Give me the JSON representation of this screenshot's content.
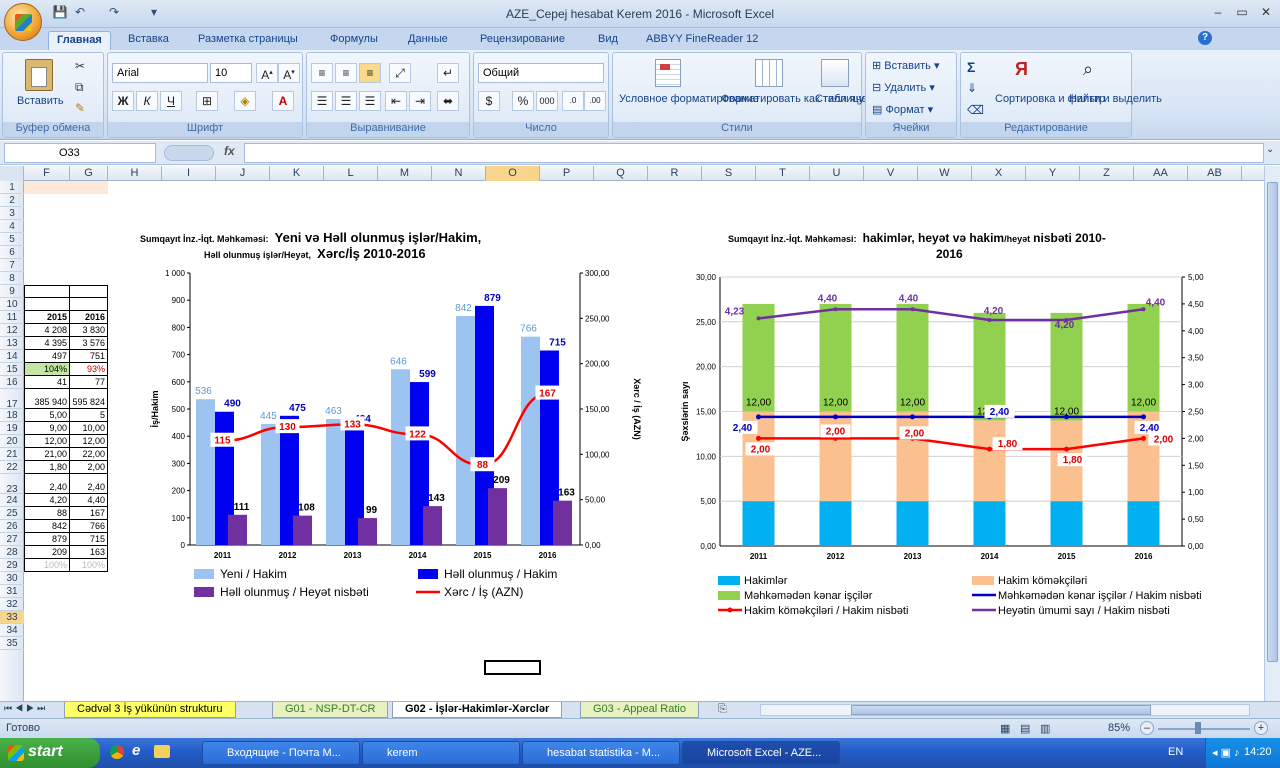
{
  "window": {
    "title": "AZE_Cepej hesabat Kerem 2016 - Microsoft Excel",
    "qat_save": "💾",
    "qat_undo": "↶",
    "qat_redo": "↷",
    "qat_more": "▾",
    "min": "–",
    "restore": "▭",
    "close": "✕"
  },
  "tabs": [
    "Главная",
    "Вставка",
    "Разметка страницы",
    "Формулы",
    "Данные",
    "Рецензирование",
    "Вид",
    "ABBYY FineReader 12"
  ],
  "ribbon": {
    "clipboard": {
      "label": "Буфер обмена",
      "paste": "Вставить"
    },
    "font": {
      "label": "Шрифт",
      "name": "Arial",
      "size": "10",
      "bold": "Ж",
      "italic": "К",
      "underline": "Ч"
    },
    "align": {
      "label": "Выравнивание"
    },
    "number": {
      "label": "Число",
      "format": "Общий",
      "percent": "%",
      "thousands": "000"
    },
    "styles": {
      "label": "Стили",
      "cond": "Условное форматирование",
      "table": "Форматировать как таблицу",
      "cellstyles": "Стили ячеек"
    },
    "cells": {
      "label": "Ячейки",
      "insert": "Вставить",
      "delete": "Удалить",
      "format": "Формат"
    },
    "editing": {
      "label": "Редактирование",
      "sum": "Σ",
      "sort": "Сортировка и фильтр",
      "find": "Найти и выделить"
    }
  },
  "formula": {
    "namebox": "O33",
    "fx": "fx",
    "value": ""
  },
  "columns": [
    "F",
    "G",
    "H",
    "I",
    "J",
    "K",
    "L",
    "M",
    "N",
    "O",
    "P",
    "Q",
    "R",
    "S",
    "T",
    "U",
    "V",
    "W",
    "X",
    "Y",
    "Z",
    "AA",
    "AB"
  ],
  "rows": [
    "1",
    "2",
    "3",
    "4",
    "5",
    "6",
    "7",
    "8",
    "9",
    "10",
    "11",
    "12",
    "13",
    "14",
    "15",
    "16",
    "17",
    "18",
    "19",
    "20",
    "21",
    "22",
    "23",
    "24",
    "25",
    "26",
    "27",
    "28",
    "29",
    "30",
    "31",
    "32",
    "33",
    "34",
    "35"
  ],
  "table": {
    "header": [
      "2015",
      "2016"
    ],
    "rows": [
      [
        "4 208",
        "3 830"
      ],
      [
        "4 395",
        "3 576"
      ],
      [
        "497",
        "751"
      ],
      [
        "104%",
        "93%"
      ],
      [
        "41",
        "77"
      ],
      [
        "385 940",
        "595 824"
      ],
      [
        "5,00",
        "5"
      ],
      [
        "9,00",
        "10,00"
      ],
      [
        "12,00",
        "12,00"
      ],
      [
        "21,00",
        "22,00"
      ],
      [
        "1,80",
        "2,00"
      ],
      [
        "2,40",
        "2,40"
      ],
      [
        "4,20",
        "4,40"
      ],
      [
        "88",
        "167"
      ],
      [
        "842",
        "766"
      ],
      [
        "879",
        "715"
      ],
      [
        "209",
        "163"
      ],
      [
        "100%",
        "100%"
      ]
    ]
  },
  "chart1": {
    "title_prefix": "Sumqayıt İnz.-İqt. Məhkəməsi:",
    "title_main": "Yeni və Həll olunmuş işlər/Hakim,",
    "title_sub_small": "Həll olunmuş işlər/Heyət,",
    "title_sub_main": "Xərc/İş 2010-2016",
    "ylabel_left": "İş/Hakim",
    "ylabel_right": "Xərc / İş (AZN)",
    "left_ticks": [
      "0",
      "100",
      "200",
      "300",
      "400",
      "500",
      "600",
      "700",
      "800",
      "900",
      "1 000"
    ],
    "right_ticks": [
      "0,00",
      "50,00",
      "100,00",
      "150,00",
      "200,00",
      "250,00",
      "300,00"
    ],
    "legend": {
      "new": "Yeni / Hakim",
      "resolved": "Həll olunmuş / Hakim",
      "staff": "Həll olunmuş / Heyət nisbəti",
      "cost": "Xərc / İş (AZN)"
    }
  },
  "chart2": {
    "title_prefix": "Sumqayıt İnz.-İqt. Məhkəməsi:",
    "title_main": "hakimlər, heyət və hakim",
    "title_small": "/heyət",
    "title_end": "nisbəti 2010-",
    "title_line2": "2016",
    "ylabel_left": "Şəxslərin sayı",
    "left_ticks": [
      "0,00",
      "5,00",
      "10,00",
      "15,00",
      "20,00",
      "25,00",
      "30,00"
    ],
    "right_ticks": [
      "0,00",
      "0,50",
      "1,00",
      "1,50",
      "2,00",
      "2,50",
      "3,00",
      "3,50",
      "4,00",
      "4,50",
      "5,00"
    ],
    "legend": {
      "judges": "Hakimlər",
      "assist": "Hakim köməkçiləri",
      "outside": "Məhkəmədən kənar işçilər",
      "outside_ratio": "Məhkəmədən kənar işçilər / Hakim nisbəti",
      "assist_ratio": "Hakim köməkçiləri / Hakim nisbəti",
      "total_ratio": "Heyətin ümumi sayı / Hakim nisbəti"
    }
  },
  "chart_data": [
    {
      "type": "bar",
      "categories": [
        "2011",
        "2012",
        "2013",
        "2014",
        "2015",
        "2016"
      ],
      "series": [
        {
          "name": "Yeni / Hakim",
          "values": [
            536,
            445,
            463,
            646,
            842,
            766
          ],
          "color": "#9dc3f0"
        },
        {
          "name": "Həll olunmuş / Hakim",
          "values": [
            490,
            475,
            434,
            599,
            879,
            715
          ],
          "color": "#0000f0"
        },
        {
          "name": "Həll olunmuş / Heyət nisbəti",
          "values": [
            111,
            108,
            99,
            143,
            209,
            163
          ],
          "color": "#7030a0"
        },
        {
          "name": "Xərc / İş (AZN)",
          "values": [
            115,
            130,
            133,
            122,
            88,
            167
          ],
          "color": "#ff0000",
          "type": "line",
          "axis": "right"
        }
      ],
      "ylim": [
        0,
        1000
      ],
      "y2lim": [
        0,
        300
      ]
    },
    {
      "type": "bar",
      "categories": [
        "2011",
        "2012",
        "2013",
        "2014",
        "2015",
        "2016"
      ],
      "series": [
        {
          "name": "Hakimlər",
          "values": [
            5,
            5,
            5,
            5,
            5,
            5
          ],
          "color": "#00b0f0"
        },
        {
          "name": "Hakim köməkçiləri",
          "values": [
            10,
            10,
            10,
            9,
            9,
            10
          ],
          "color": "#fac090"
        },
        {
          "name": "Məhkəmədən kənar işçilər",
          "values": [
            12,
            12,
            12,
            12,
            12,
            12
          ],
          "color": "#92d050"
        },
        {
          "name": "Məhkəmədən kənar işçilər / Hakim nisbəti",
          "values": [
            2.4,
            2.4,
            2.4,
            2.4,
            2.4,
            2.4
          ],
          "color": "#0000c0",
          "type": "line",
          "axis": "right"
        },
        {
          "name": "Hakim köməkçiləri / Hakim nisbəti",
          "values": [
            2.0,
            2.0,
            2.0,
            1.8,
            1.8,
            2.0
          ],
          "color": "#ff0000",
          "type": "line",
          "axis": "right"
        },
        {
          "name": "Heyətin ümumi sayı / Hakim nisbəti",
          "values": [
            4.23,
            4.4,
            4.4,
            4.2,
            4.2,
            4.4
          ],
          "color": "#7030a0",
          "type": "line",
          "axis": "right"
        }
      ],
      "ylim": [
        0,
        30
      ],
      "y2lim": [
        0,
        5
      ]
    }
  ],
  "sheets": [
    "Cədvəl 3 İş yükünün strukturu",
    "G01 - NSP-DT-CR",
    "G02 - İşlər-Hakimlər-Xərclər",
    "G03 - Appeal Ratio"
  ],
  "status": {
    "ready": "Готово",
    "zoom": "85%"
  },
  "taskbar": {
    "start": "start",
    "tasks": [
      "Входящие - Почта М...",
      "kerem",
      "hesabat statistika - M...",
      "Microsoft Excel - AZE..."
    ],
    "lang": "EN",
    "time": "14:20"
  }
}
